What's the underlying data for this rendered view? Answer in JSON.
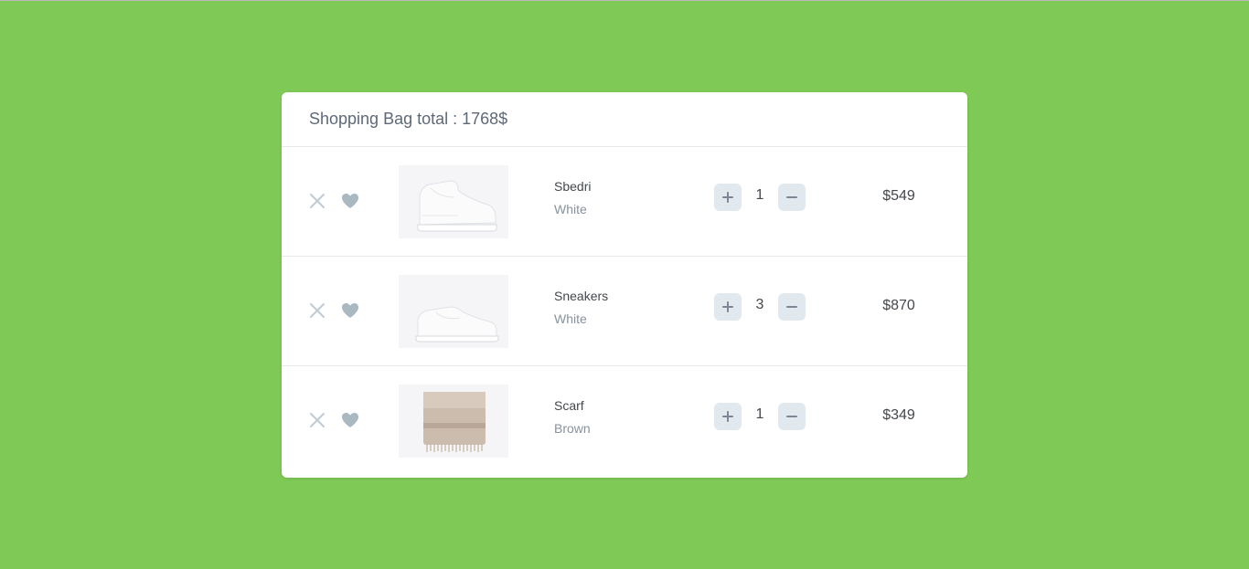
{
  "header": {
    "title": "Shopping Bag total : 1768$"
  },
  "items": [
    {
      "name": "Sbedri",
      "color": "White",
      "quantity": "1",
      "price": "$549",
      "image": "high-top-sneaker"
    },
    {
      "name": "Sneakers",
      "color": "White",
      "quantity": "3",
      "price": "$870",
      "image": "low-sneaker"
    },
    {
      "name": "Scarf",
      "color": "Brown",
      "quantity": "1",
      "price": "$349",
      "image": "scarf"
    }
  ],
  "icons": {
    "delete": "close-icon",
    "like": "heart-icon",
    "increase": "plus-icon",
    "decrease": "minus-icon"
  },
  "colors": {
    "background": "#7fc956",
    "card": "#ffffff",
    "button": "#e1e8ee",
    "icon": "#c1cad4"
  }
}
